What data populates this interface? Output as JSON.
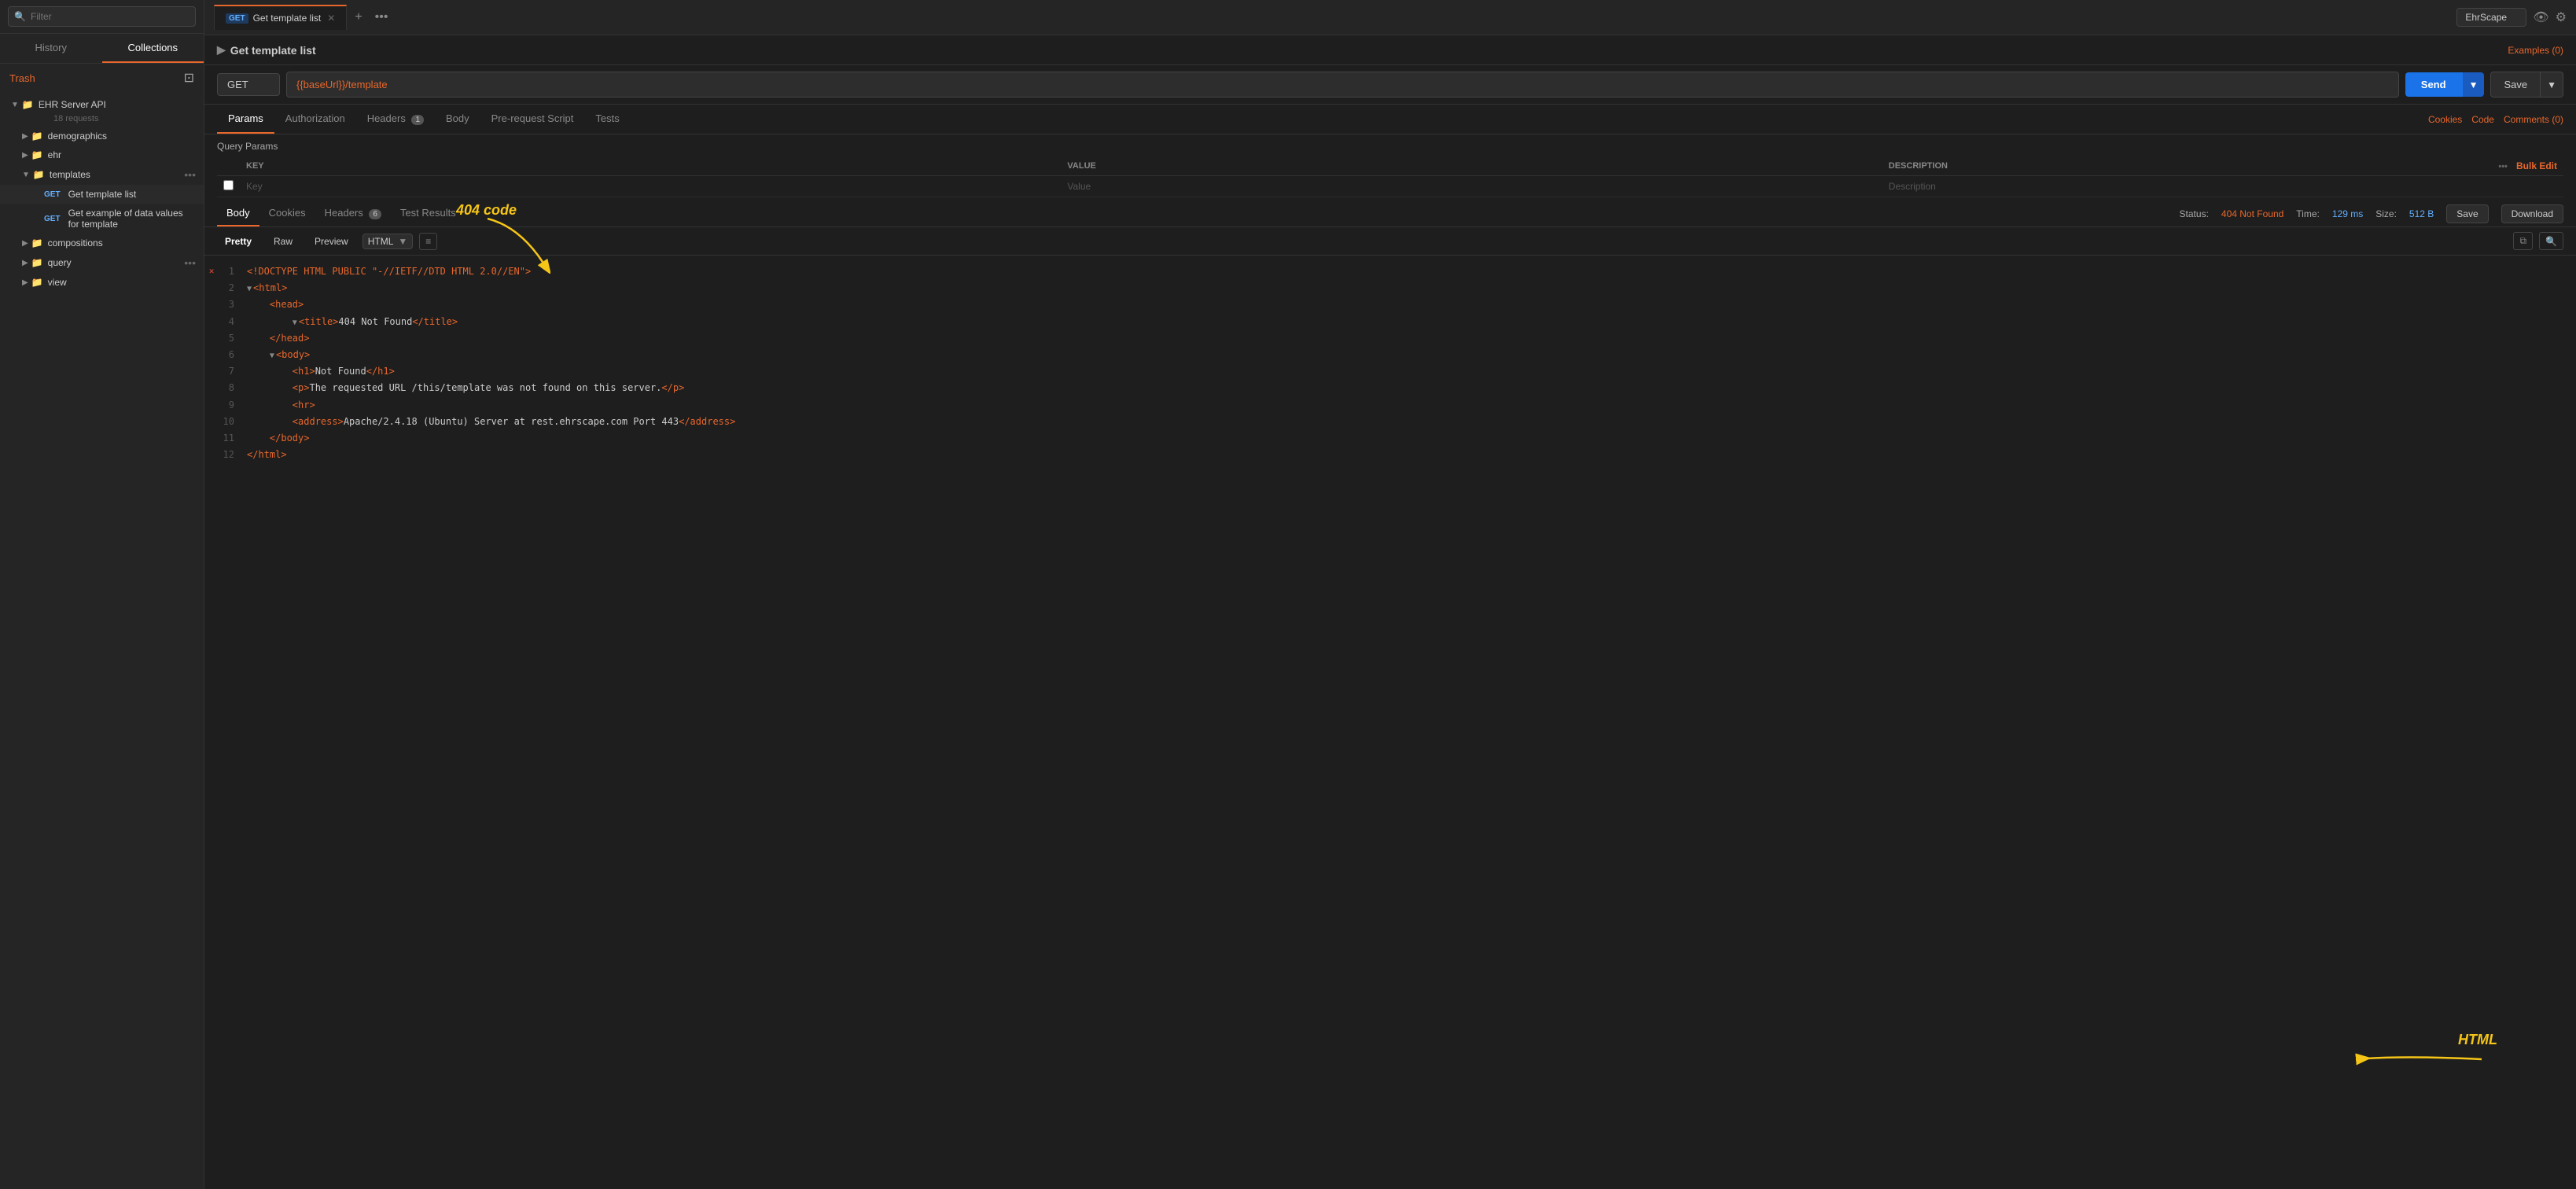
{
  "sidebar": {
    "search_placeholder": "Filter",
    "tabs": [
      {
        "label": "History",
        "active": false
      },
      {
        "label": "Collections",
        "active": true
      }
    ],
    "trash_label": "Trash",
    "collection": {
      "name": "EHR Server API",
      "requests_count": "18 requests",
      "folders": [
        {
          "name": "demographics",
          "expanded": false
        },
        {
          "name": "ehr",
          "expanded": false
        },
        {
          "name": "templates",
          "expanded": true,
          "items": [
            {
              "method": "GET",
              "label": "Get template list",
              "selected": true
            },
            {
              "method": "GET",
              "label": "Get example of data values for template",
              "selected": false
            }
          ]
        },
        {
          "name": "compositions",
          "expanded": false
        },
        {
          "name": "query",
          "expanded": false
        },
        {
          "name": "view",
          "expanded": false
        }
      ]
    }
  },
  "tab_bar": {
    "tabs": [
      {
        "method": "GET",
        "label": "Get template list",
        "active": true
      }
    ],
    "add_label": "+",
    "more_label": "•••"
  },
  "topbar": {
    "env_value": "EhrScape",
    "env_options": [
      "EhrScape"
    ],
    "eye_icon": "👁",
    "gear_icon": "⚙"
  },
  "request": {
    "title": "Get template list",
    "examples_label": "Examples (0)",
    "method": "GET",
    "url": "{{baseUrl}}/template",
    "send_label": "Send",
    "save_label": "Save"
  },
  "params_tabs": {
    "tabs": [
      {
        "label": "Params",
        "active": true
      },
      {
        "label": "Authorization",
        "active": false
      },
      {
        "label": "Headers",
        "active": false,
        "badge": "1"
      },
      {
        "label": "Body",
        "active": false
      },
      {
        "label": "Pre-request Script",
        "active": false
      },
      {
        "label": "Tests",
        "active": false
      }
    ],
    "cookies_label": "Cookies",
    "code_label": "Code",
    "comments_label": "Comments (0)"
  },
  "query_params": {
    "section_label": "Query Params",
    "columns": [
      "KEY",
      "VALUE",
      "DESCRIPTION"
    ],
    "bulk_edit_label": "Bulk Edit",
    "placeholder_key": "Key",
    "placeholder_value": "Value",
    "placeholder_desc": "Description"
  },
  "response": {
    "tabs": [
      {
        "label": "Body",
        "active": true
      },
      {
        "label": "Cookies",
        "active": false
      },
      {
        "label": "Headers",
        "active": false,
        "badge": "6"
      },
      {
        "label": "Test Results",
        "active": false
      }
    ],
    "status_label": "Status:",
    "status_value": "404 Not Found",
    "time_label": "Time:",
    "time_value": "129 ms",
    "size_label": "Size:",
    "size_value": "512 B",
    "save_label": "Save",
    "download_label": "Download"
  },
  "format_bar": {
    "pretty_label": "Pretty",
    "raw_label": "Raw",
    "preview_label": "Preview",
    "format_value": "HTML",
    "wrap_icon": "≡",
    "copy_icon": "⧉",
    "search_icon": "🔍"
  },
  "code_lines": [
    {
      "num": 1,
      "error": true,
      "content": "<!DOCTYPE HTML PUBLIC \"-//IETF//DTD HTML 2.0//EN\">"
    },
    {
      "num": 2,
      "expandable": true,
      "content": "<html>"
    },
    {
      "num": 3,
      "content": "    <head>"
    },
    {
      "num": 4,
      "expandable": true,
      "content": "        <title>404 Not Found</title>"
    },
    {
      "num": 5,
      "content": "    </head>"
    },
    {
      "num": 6,
      "expandable": true,
      "content": "    <body>"
    },
    {
      "num": 7,
      "content": "        <h1>Not Found</h1>"
    },
    {
      "num": 8,
      "content": "        <p>The requested URL /this/template was not found on this server.</p>"
    },
    {
      "num": 9,
      "content": "        <hr>"
    },
    {
      "num": 10,
      "content": "        <address>Apache/2.4.18 (Ubuntu) Server at rest.ehrscape.com Port 443</address>"
    },
    {
      "num": 11,
      "content": "    </body>"
    },
    {
      "num": 12,
      "content": "</html>"
    }
  ],
  "annotations": {
    "code_label": "404 code",
    "html_label": "HTML"
  }
}
